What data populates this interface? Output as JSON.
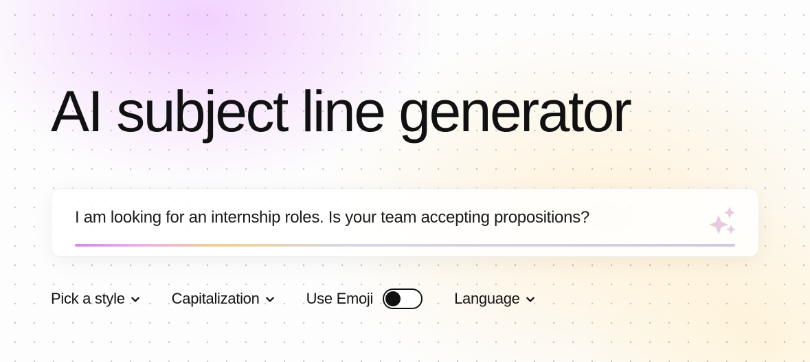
{
  "title": "AI subject line generator",
  "input": {
    "value": "I am looking for an internship roles. Is your team accepting propositions?"
  },
  "controls": {
    "style": {
      "label": "Pick a style"
    },
    "capitalization": {
      "label": "Capitalization"
    },
    "emoji": {
      "label": "Use Emoji",
      "enabled": false
    },
    "language": {
      "label": "Language"
    }
  }
}
